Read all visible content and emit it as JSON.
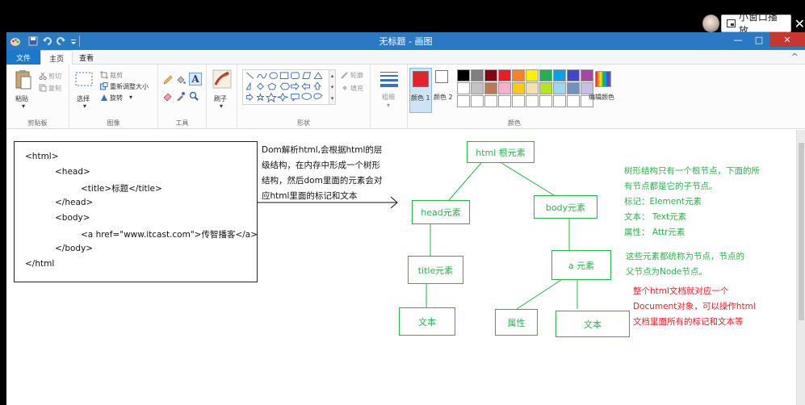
{
  "overlay": {
    "pip_label": "小窗口播放",
    "close_glyph": "✕"
  },
  "window": {
    "title": "无标题 - 画图",
    "minimize": "—",
    "maximize": "□",
    "close": "✕"
  },
  "tabs": {
    "file": "文件",
    "home": "主页",
    "view": "查看",
    "collapse": "^"
  },
  "ribbon": {
    "clipboard": {
      "paste": "粘贴",
      "cut": "剪切",
      "copy": "复制",
      "label": "剪贴板"
    },
    "image": {
      "select": "选择",
      "crop": "裁剪",
      "resize": "重新调整大小",
      "rotate": "旋转",
      "label": "图像"
    },
    "tools": {
      "label": "工具"
    },
    "brushes": {
      "brush": "刷子"
    },
    "shapes": {
      "outline": "轮廓",
      "fill": "填充",
      "label": "形状"
    },
    "size": {
      "label": "粗细"
    },
    "colors": {
      "color1": "颜色 1",
      "color2": "颜色 2",
      "edit": "编辑颜色",
      "label": "颜色",
      "color1_value": "#e5222b",
      "color2_value": "#ffffff",
      "palette": [
        "#000000",
        "#7f7f7f",
        "#880015",
        "#ed1c24",
        "#ff7f27",
        "#fff200",
        "#22b14c",
        "#00a2e8",
        "#3f48cc",
        "#a349a4",
        "#ffffff",
        "#c3c3c3",
        "#b97a57",
        "#ffaec9",
        "#ffc90e",
        "#efe4b0",
        "#b5e61d",
        "#99d9ea",
        "#7092be",
        "#c8bfe7",
        "#ffffff",
        "#ffffff",
        "#ffffff",
        "#ffffff",
        "#ffffff",
        "#ffffff",
        "#ffffff",
        "#ffffff",
        "#ffffff",
        "#ffffff"
      ]
    }
  },
  "canvas": {
    "code_lines": [
      "<html>",
      "<head>",
      "<title>标题</title>",
      "</head>",
      "<body>",
      "<a href=\"www.itcast.com\">传智播客</a>",
      "</body>",
      "</html"
    ],
    "description": [
      "Dom解析html,会根据html的层",
      "级结构，在内存中形成一个树形",
      "结构，然后dom里面的元素会对",
      "应html里面的标记和文本"
    ],
    "nodes": {
      "root": "html 根元素",
      "head": "head元素",
      "body": "body元素",
      "title": "title元素",
      "text1": "文本",
      "a": "a 元素",
      "attr": "属性",
      "text2": "文本"
    },
    "notes_green_1": [
      "树形结构只有一个根节点，下面的所",
      "有节点都是它的子节点。",
      "标记：Element元素",
      "文本：  Text元素",
      "属性：   Attr元素"
    ],
    "notes_green_2": [
      "这些元素都统称为节点，节点的",
      "父节点为Node节点。"
    ],
    "notes_red": [
      "整个html文档就对应一个",
      "Document对象，可以操作html",
      "文档里面所有的标记和文本等"
    ]
  }
}
